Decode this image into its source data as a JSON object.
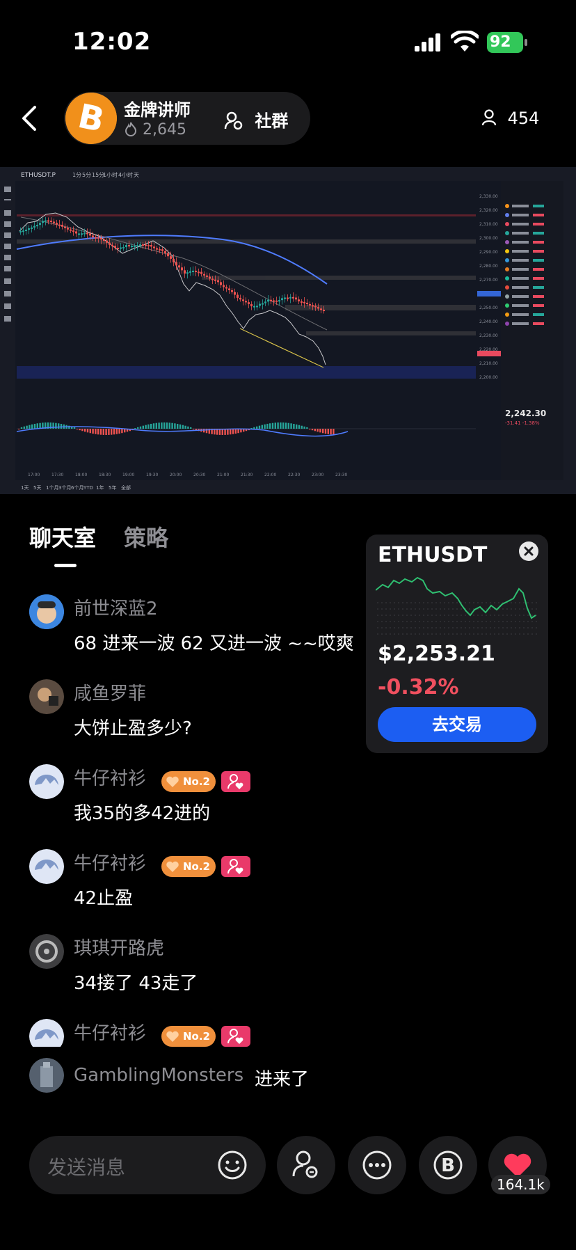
{
  "status_bar": {
    "time": "12:02",
    "battery": "92"
  },
  "header": {
    "host_name": "金牌讲师",
    "heat": "2,645",
    "community_label": "社群",
    "viewer_count": "454"
  },
  "chart_panel": {
    "symbol": "ETHUSDT.P",
    "timeframes": [
      "1分",
      "5分",
      "15分",
      "1小时",
      "4小时",
      "天"
    ],
    "side_price": "2,242.30",
    "side_change": "-31.41  -1.38%",
    "ranges": [
      "1天",
      "5天",
      "1个月",
      "3个月",
      "6个月",
      "YTD",
      "1年",
      "5年",
      "全部"
    ],
    "time_ticks": [
      "17:00",
      "17:30",
      "18:00",
      "18:30",
      "19:00",
      "19:30",
      "20:00",
      "20:30",
      "21:00",
      "21:30",
      "22:00",
      "22:30",
      "23:00",
      "23:30"
    ],
    "price_ticks": [
      "2,330.00",
      "2,320.00",
      "2,310.00",
      "2,300.00",
      "2,290.00",
      "2,280.00",
      "2,270.00",
      "2,260.00",
      "2,250.00",
      "2,240.00",
      "2,230.00",
      "2,220.00",
      "2,210.00",
      "2,200.00"
    ]
  },
  "tabs": {
    "chat": "聊天室",
    "strategy": "策略"
  },
  "messages": [
    {
      "user": "前世深蓝2",
      "text": "68 进来一波  62 又进一波 ~~哎爽"
    },
    {
      "user": "咸鱼罗菲",
      "text": "大饼止盈多少?"
    },
    {
      "user": "牛仔衬衫",
      "badge": "No.2",
      "text": "我35的多42进的"
    },
    {
      "user": "牛仔衬衫",
      "badge": "No.2",
      "text": "42止盈"
    },
    {
      "user": "琪琪开路虎",
      "text": "34接了   43走了"
    },
    {
      "user": "牛仔衬衫",
      "badge": "No.2",
      "text": ""
    }
  ],
  "join_notice": {
    "user": "GamblingMonsters",
    "text": "进来了"
  },
  "eth_card": {
    "symbol": "ETHUSDT",
    "price": "$2,253.21",
    "change": "-0.32%",
    "trade_label": "去交易",
    "up_color": "#2fbf71",
    "down_color": "#f0505f"
  },
  "bottom_bar": {
    "input_placeholder": "发送消息",
    "like_count": "164.1k"
  }
}
